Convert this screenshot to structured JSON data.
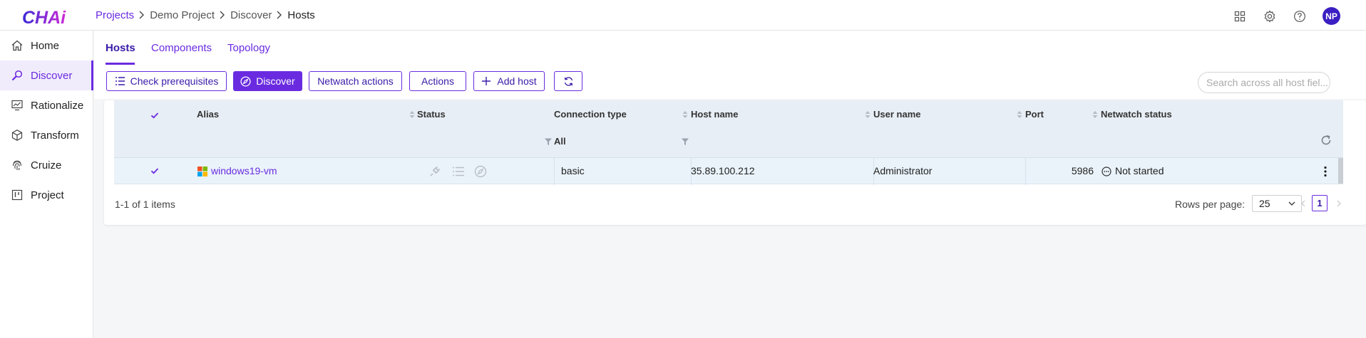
{
  "app": {
    "logo_text": "CHAi"
  },
  "breadcrumb": {
    "items": [
      "Projects",
      "Demo Project",
      "Discover",
      "Hosts"
    ]
  },
  "header": {
    "avatar_initials": "NP",
    "icons": [
      "apps-grid-icon",
      "gear-icon",
      "help-icon"
    ]
  },
  "sidebar": {
    "items": [
      {
        "label": "Home",
        "icon": "home-icon"
      },
      {
        "label": "Discover",
        "icon": "discover-icon",
        "active": true
      },
      {
        "label": "Rationalize",
        "icon": "rationalize-icon"
      },
      {
        "label": "Transform",
        "icon": "cube-icon"
      },
      {
        "label": "Cruize",
        "icon": "fingerprint-icon"
      },
      {
        "label": "Project",
        "icon": "board-icon"
      }
    ]
  },
  "tabs": [
    {
      "label": "Hosts",
      "active": true
    },
    {
      "label": "Components"
    },
    {
      "label": "Topology"
    }
  ],
  "toolbar": {
    "check_prerequisites": "Check prerequisites",
    "discover": "Discover",
    "netwatch_actions": "Netwatch actions",
    "actions": "Actions",
    "add_host": "Add host",
    "search_placeholder": "Search across all host fiel..."
  },
  "table": {
    "columns": [
      "Alias",
      "Status",
      "Connection type",
      "Host name",
      "User name",
      "Port",
      "Netwatch status"
    ],
    "filters": {
      "connection_type": "All"
    },
    "rows": [
      {
        "alias": "windows19-vm",
        "connection_type": "basic",
        "host_name": "35.89.100.212",
        "user_name": "Administrator",
        "port": "5986",
        "netwatch_status": "Not started"
      }
    ]
  },
  "footer": {
    "count_text": "1-1 of 1 items",
    "rows_per_page_label": "Rows per page:",
    "rows_per_page_value": "25",
    "current_page": "1"
  },
  "colors": {
    "accent": "#6a2be0",
    "accent_dark": "#3a1aa8",
    "header_bg": "#e8eef5",
    "row_bg": "#eaf3fa",
    "avatar": "#3b1fc2"
  }
}
